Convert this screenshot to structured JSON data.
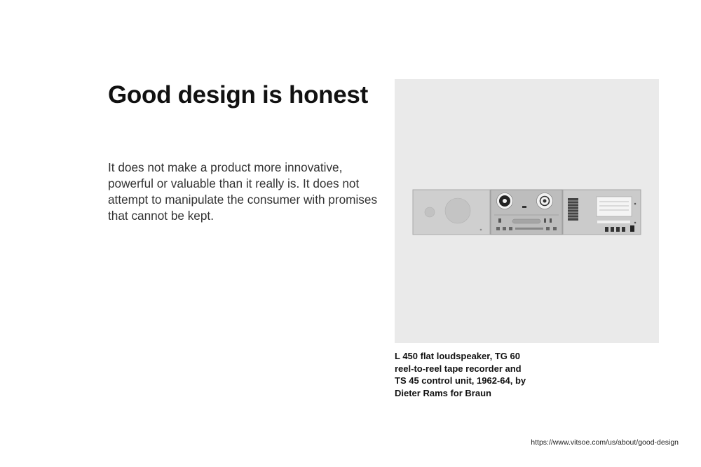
{
  "heading": "Good design is honest",
  "body": "It does not make a product more innovative, powerful or valuable than it really is. It does not attempt to manipulate the consumer with promises that cannot be kept.",
  "figure": {
    "caption": "L 450 flat loudspeaker, TG 60 reel-to-reel tape recorder and TS 45 control unit, 1962-64, by Dieter Rams for Braun",
    "background_color": "#eaeaea"
  },
  "source_url": "https://www.vitsoe.com/us/about/good-design"
}
